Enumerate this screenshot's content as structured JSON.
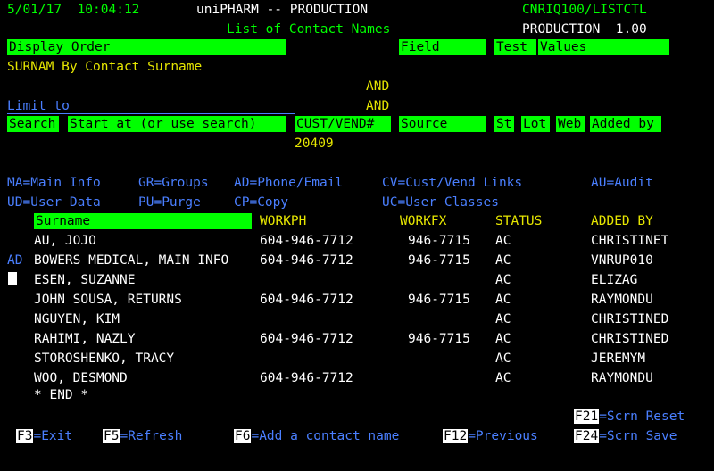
{
  "header": {
    "datetime": "5/01/17  10:04:12",
    "app": "uniPHARM -- PRODUCTION",
    "program": "CNRIQ100/LISTCTL",
    "title": "List of Contact Names",
    "env": "PRODUCTION  1.00"
  },
  "form": {
    "display_order_label": "Display Order",
    "field_label": "Field",
    "test_label": "Test",
    "values_label": "Values",
    "display_order_value": "SURNAM By Contact Surname",
    "and1": "AND",
    "and2": "AND",
    "limit_to": "Limit to",
    "search": "Search",
    "start_at": "Start at (or use search)",
    "cust_vend": "CUST/VEND#",
    "source": "Source",
    "st": "St",
    "lot": "Lot",
    "web": "Web",
    "added_by": "Added by",
    "cust_vend_value": "20409"
  },
  "commands": {
    "ma": "MA=Main Info",
    "gr": "GR=Groups",
    "ad": "AD=Phone/Email",
    "cv": "CV=Cust/Vend Links",
    "au": "AU=Audit",
    "ud": "UD=User Data",
    "pu": "PU=Purge",
    "cp": "CP=Copy",
    "uc": "UC=User Classes"
  },
  "table": {
    "headers": {
      "surname": "Surname",
      "workph": "WORKPH",
      "workfx": "WORKFX",
      "status": "STATUS",
      "added_by": "ADDED BY"
    },
    "rows": [
      {
        "action": "",
        "surname": "AU, JOJO",
        "workph": "604-946-7712",
        "workfx": "946-7715",
        "status": "AC",
        "added_by": "CHRISTINET"
      },
      {
        "action": "AD",
        "surname": "BOWERS MEDICAL, MAIN INFO",
        "workph": "604-946-7712",
        "workfx": "946-7715",
        "status": "AC",
        "added_by": "VNRUP010"
      },
      {
        "action": "",
        "surname": "ESEN, SUZANNE",
        "workph": "",
        "workfx": "",
        "status": "AC",
        "added_by": "ELIZAG"
      },
      {
        "action": "",
        "surname": "JOHN SOUSA, RETURNS",
        "workph": "604-946-7712",
        "workfx": "946-7715",
        "status": "AC",
        "added_by": "RAYMONDU"
      },
      {
        "action": "",
        "surname": "NGUYEN, KIM",
        "workph": "",
        "workfx": "",
        "status": "AC",
        "added_by": "CHRISTINED"
      },
      {
        "action": "",
        "surname": "RAHIMI, NAZLY",
        "workph": "604-946-7712",
        "workfx": "946-7715",
        "status": "AC",
        "added_by": "CHRISTINED"
      },
      {
        "action": "",
        "surname": "STOROSHENKO, TRACY",
        "workph": "",
        "workfx": "",
        "status": "AC",
        "added_by": "JEREMYM"
      },
      {
        "action": "",
        "surname": "WOO, DESMOND",
        "workph": "604-946-7712",
        "workfx": "",
        "status": "AC",
        "added_by": "RAYMONDU"
      }
    ],
    "end": "* END *"
  },
  "fkeys": {
    "f21_key": "F21",
    "f21_label": "=Scrn Reset",
    "f3_key": "F3",
    "f3_label": "=Exit",
    "f5_key": "F5",
    "f5_label": "=Refresh",
    "f6_key": "F6",
    "f6_label": "=Add a contact name",
    "f12_key": "F12",
    "f12_label": "=Previous",
    "f24_key": "F24",
    "f24_label": "=Scrn Save"
  }
}
